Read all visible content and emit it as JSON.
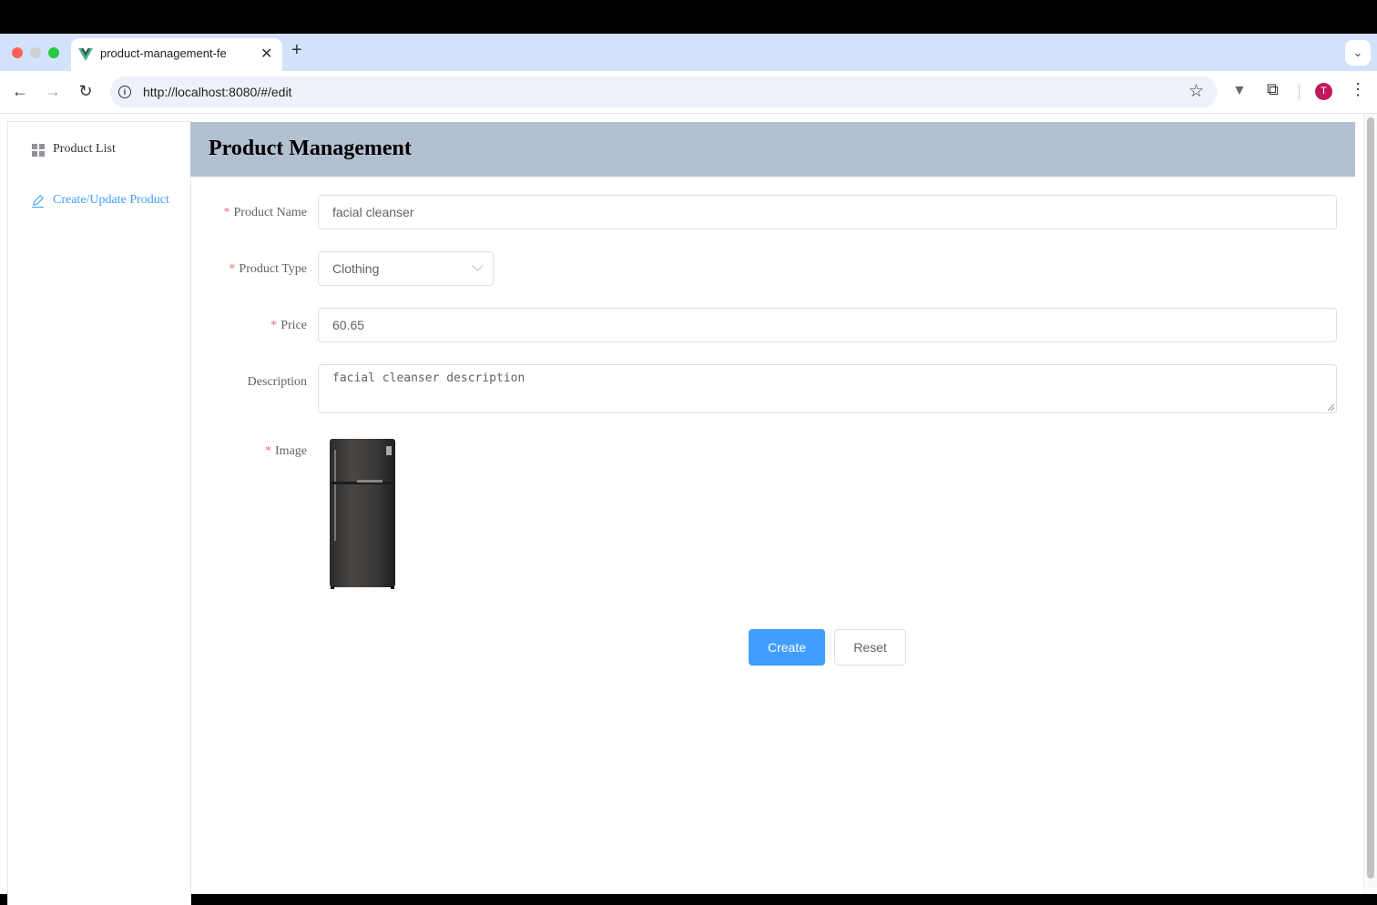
{
  "browser": {
    "tab_title": "product-management-fe",
    "url": "http://localhost:8080/#/edit",
    "avatar_initial": "T"
  },
  "sidebar": {
    "items": [
      {
        "label": "Product List",
        "icon": "grid-icon",
        "active": false
      },
      {
        "label": "Create/Update Product",
        "icon": "edit-icon",
        "active": true
      }
    ]
  },
  "header": {
    "title": "Product Management"
  },
  "form": {
    "product_name": {
      "label": "Product Name",
      "required": true,
      "value": "facial cleanser"
    },
    "product_type": {
      "label": "Product Type",
      "required": true,
      "value": "Clothing"
    },
    "price": {
      "label": "Price",
      "required": true,
      "value": "60.65"
    },
    "description": {
      "label": "Description",
      "required": false,
      "value": "facial cleanser description"
    },
    "image": {
      "label": "Image",
      "required": true,
      "alt": "refrigerator"
    },
    "create_label": "Create",
    "reset_label": "Reset"
  },
  "colors": {
    "accent": "#409eff",
    "header_bg": "#b3c0d1",
    "required": "#f56c6c"
  }
}
